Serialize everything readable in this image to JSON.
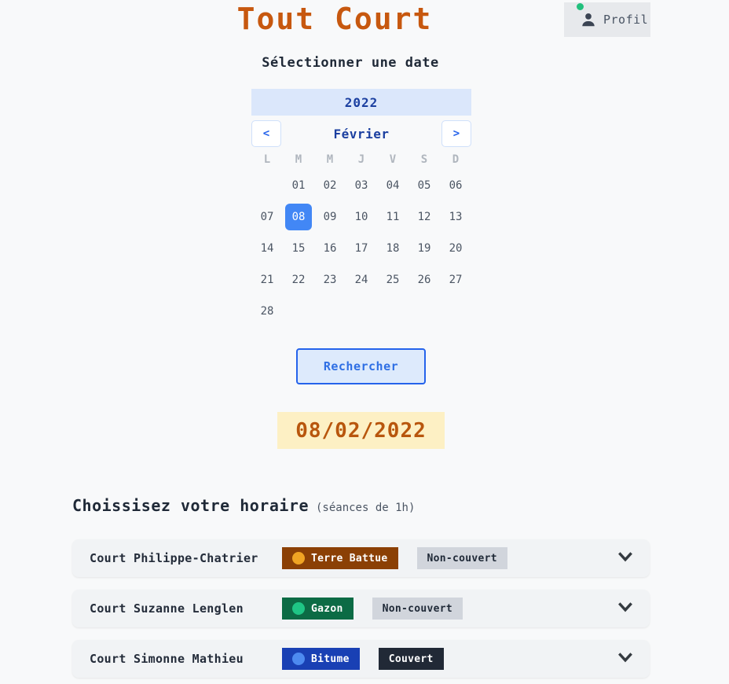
{
  "app": {
    "title": "Tout Court",
    "title_color": "#c7580f",
    "subtitle": "Sélectionner une date"
  },
  "profile": {
    "label": "Profil",
    "status_color": "#22c07d",
    "icon": "person-icon"
  },
  "calendar": {
    "year": "2022",
    "month": "Février",
    "prev_label": "<",
    "next_label": ">",
    "weekdays": [
      "L",
      "M",
      "M",
      "J",
      "V",
      "S",
      "D"
    ],
    "leading_blanks": 1,
    "days": [
      "01",
      "02",
      "03",
      "04",
      "05",
      "06",
      "07",
      "08",
      "09",
      "10",
      "11",
      "12",
      "13",
      "14",
      "15",
      "16",
      "17",
      "18",
      "19",
      "20",
      "21",
      "22",
      "23",
      "24",
      "25",
      "26",
      "27",
      "28"
    ],
    "selected_day": "08",
    "selected_color": "#4287f5",
    "year_bar_color": "#dbe7fb"
  },
  "search": {
    "button_label": "Rechercher",
    "selected_date": "08/02/2022",
    "pill_bg": "#fdf0c4",
    "pill_text_color": "#b8560d"
  },
  "schedule": {
    "title": "Choissisez votre horaire",
    "subtitle": "(séances de 1h)",
    "courts": [
      {
        "name": "Court Philippe-Chatrier",
        "surface": "Terre Battue",
        "surface_bg": "#8b4005",
        "surface_dot": "#f0a423",
        "cover": "Non-couvert",
        "cover_bg": "#d1d5dc",
        "cover_color": "#1f2937",
        "expand_icon": "chevron-down-icon"
      },
      {
        "name": "Court Suzanne Lenglen",
        "surface": "Gazon",
        "surface_bg": "#0c6b45",
        "surface_dot": "#1fc585",
        "cover": "Non-couvert",
        "cover_bg": "#d1d5dc",
        "cover_color": "#1f2937",
        "expand_icon": "chevron-down-icon"
      },
      {
        "name": "Court Simonne Mathieu",
        "surface": "Bitume",
        "surface_bg": "#1940b4",
        "surface_dot": "#4d8af0",
        "cover": "Couvert",
        "cover_bg": "#212936",
        "cover_color": "#ffffff",
        "expand_icon": "chevron-down-icon"
      }
    ]
  }
}
